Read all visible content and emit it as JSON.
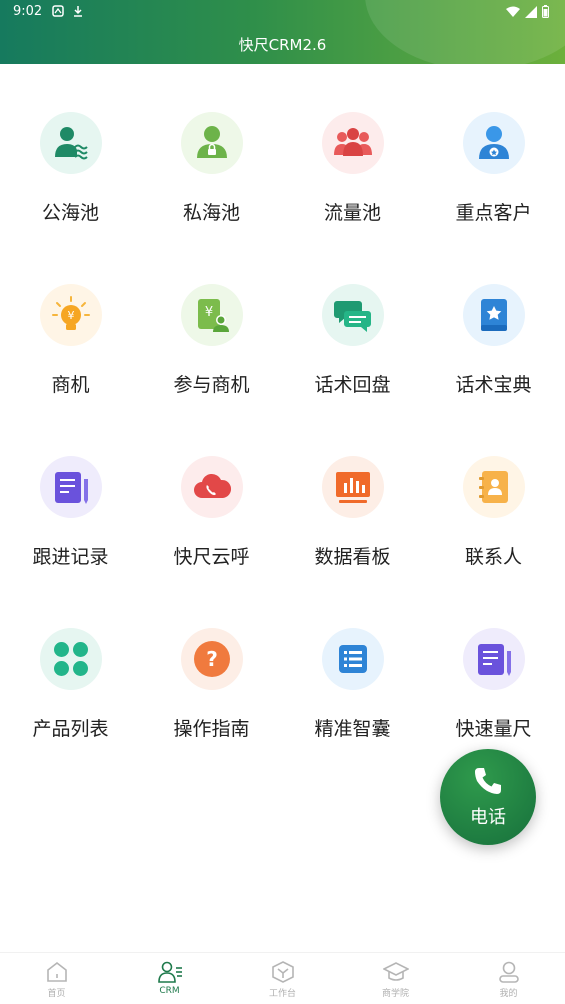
{
  "status_bar": {
    "time": "9:02"
  },
  "header": {
    "title": "快尺CRM2.6"
  },
  "grid": {
    "items": [
      {
        "label": "公海池",
        "icon": "public-pool-icon"
      },
      {
        "label": "私海池",
        "icon": "private-pool-icon"
      },
      {
        "label": "流量池",
        "icon": "traffic-pool-icon"
      },
      {
        "label": "重点客户",
        "icon": "key-customer-icon"
      },
      {
        "label": "商机",
        "icon": "business-opportunity-icon"
      },
      {
        "label": "参与商机",
        "icon": "joined-opportunity-icon"
      },
      {
        "label": "话术回盘",
        "icon": "script-review-icon"
      },
      {
        "label": "话术宝典",
        "icon": "script-handbook-icon"
      },
      {
        "label": "跟进记录",
        "icon": "follow-up-record-icon"
      },
      {
        "label": "快尺云呼",
        "icon": "cloud-call-icon"
      },
      {
        "label": "数据看板",
        "icon": "data-dashboard-icon"
      },
      {
        "label": "联系人",
        "icon": "contacts-icon"
      },
      {
        "label": "产品列表",
        "icon": "product-list-icon"
      },
      {
        "label": "操作指南",
        "icon": "operation-guide-icon"
      },
      {
        "label": "精准智囊",
        "icon": "precision-think-tank-icon"
      },
      {
        "label": "快速量尺",
        "icon": "quick-measure-icon"
      }
    ]
  },
  "fab": {
    "label": "电话",
    "icon": "phone-icon"
  },
  "bottom_nav": {
    "items": [
      {
        "label": "首页",
        "icon": "home-icon"
      },
      {
        "label": "CRM",
        "icon": "crm-icon"
      },
      {
        "label": "工作台",
        "icon": "workbench-icon"
      },
      {
        "label": "商学院",
        "icon": "academy-icon"
      },
      {
        "label": "我的",
        "icon": "profile-icon"
      }
    ],
    "active_index": 1
  },
  "colors": {
    "accent": "#1f7a4c",
    "header_start": "#167a5e",
    "header_end": "#6cb03c"
  }
}
